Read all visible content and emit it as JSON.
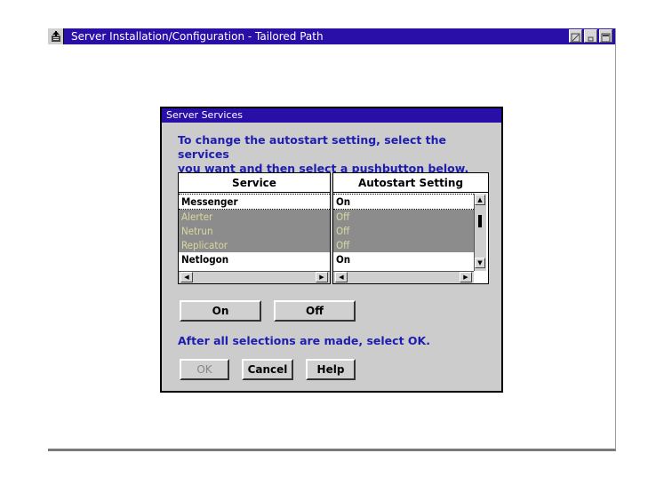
{
  "window": {
    "title": "Server Installation/Configuration - Tailored Path"
  },
  "dialog": {
    "title": "Server Services",
    "instruction_line1": "To change the autostart setting, select the services",
    "instruction_line2": "you want and then select a pushbutton below.",
    "columns": {
      "service": "Service",
      "autostart": "Autostart Setting"
    },
    "rows": [
      {
        "service": "Messenger",
        "setting": "On",
        "selected": false
      },
      {
        "service": "Alerter",
        "setting": "Off",
        "selected": true
      },
      {
        "service": "Netrun",
        "setting": "Off",
        "selected": true
      },
      {
        "service": "Replicator",
        "setting": "Off",
        "selected": true
      },
      {
        "service": "Netlogon",
        "setting": "On",
        "selected": false
      }
    ],
    "on_button": "On",
    "off_button": "Off",
    "after_text": "After all selections are made, select OK.",
    "ok_button": "OK",
    "cancel_button": "Cancel",
    "help_button": "Help"
  }
}
